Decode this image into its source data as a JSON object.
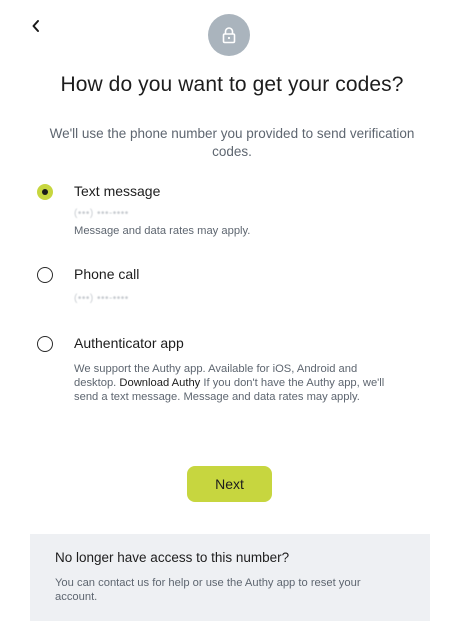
{
  "header": {
    "back_icon": "chevron-left-icon",
    "lock_icon": "lock-icon",
    "lock_circle_color": "#aab4bd"
  },
  "title": "How do you want to get your codes?",
  "subtitle": "We'll use the phone number you provided to send verification codes.",
  "options": [
    {
      "label": "Text message",
      "masked_number": "(•••) •••-••••",
      "description": "Message and data rates may apply.",
      "checked": true
    },
    {
      "label": "Phone call",
      "masked_number": "(•••) •••-••••",
      "checked": false
    },
    {
      "label": "Authenticator app",
      "description_before": "We support the Authy app. Available for iOS, Android and desktop.",
      "link_text": "Download Authy",
      "description_after": "If you don't have the Authy app, we'll send a text message. Message and data rates may apply.",
      "checked": false
    }
  ],
  "next_label": "Next",
  "help": {
    "title": "No longer have access to this number?",
    "text": "You can contact us for help or use the Authy app to reset your account."
  },
  "colors": {
    "accent": "#c7d63f",
    "help_background": "#eef0f3",
    "muted_text": "#5e6670"
  }
}
